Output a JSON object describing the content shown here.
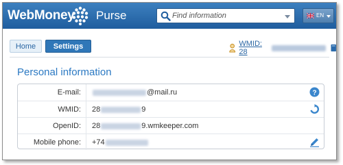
{
  "header": {
    "logo_text": "WebMoney",
    "product_name": "Purse",
    "search_placeholder": "Find information",
    "language_code": "EN"
  },
  "nav": {
    "tabs": [
      {
        "label": "Home",
        "active": false
      },
      {
        "label": "Settings",
        "active": true
      }
    ],
    "wmid_prefix": "WMID: 28"
  },
  "personal_info": {
    "title": "Personal information",
    "rows": [
      {
        "label": "E-mail:",
        "value_suffix": "@mail.ru",
        "action_icon": "help-icon"
      },
      {
        "label": "WMID:",
        "value_prefix": "28",
        "value_suffix": "9",
        "action_icon": "refresh-icon"
      },
      {
        "label": "OpenID:",
        "value_prefix": "28",
        "value_suffix": "9.wmkeeper.com"
      },
      {
        "label": "Mobile phone:",
        "value_prefix": "+74",
        "action_icon": "edit-icon"
      }
    ]
  },
  "colors": {
    "header_blue": "#2a6aab",
    "accent": "#2a78c2",
    "tab_active": "#2f77b8"
  }
}
